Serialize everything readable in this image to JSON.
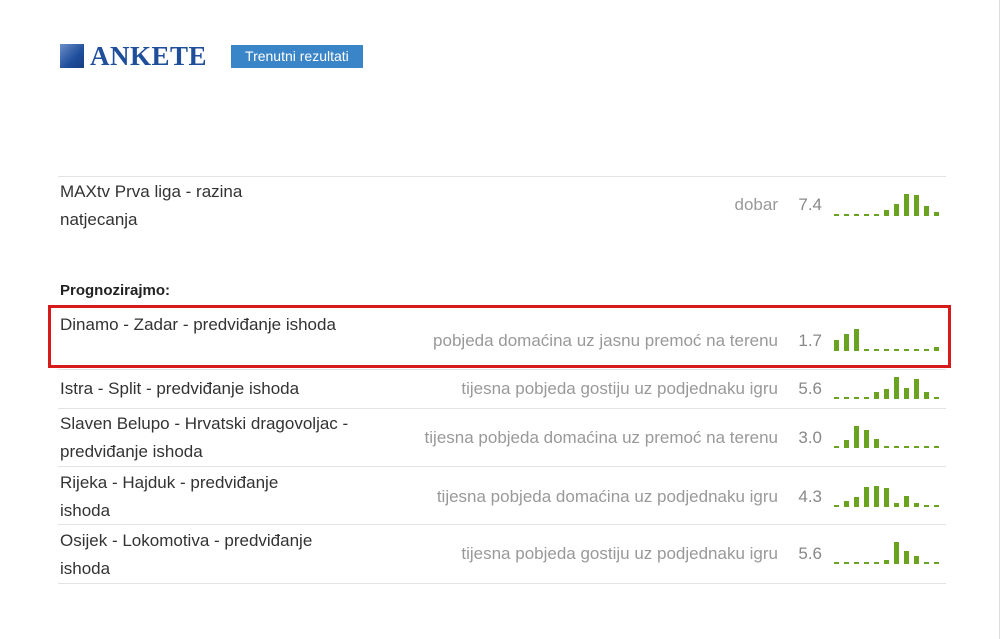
{
  "header": {
    "title": "ANKETE",
    "results_link": "Trenutni rezultati"
  },
  "league_poll": {
    "name": "MAXtv Prva liga - razina natjecanja",
    "answer": "dobar",
    "score": "7.4",
    "distribution": [
      0,
      0,
      0,
      0,
      0,
      0.25,
      0.55,
      1.0,
      0.95,
      0.45,
      0.15
    ]
  },
  "section_title": "Prognozirajmo:",
  "match_polls": [
    {
      "name": "Dinamo - Zadar - predviđanje ishoda",
      "answer": "pobjeda domaćina uz jasnu premoć na terenu",
      "score": "1.7",
      "distribution": [
        0.5,
        0.75,
        1.0,
        0,
        0,
        0,
        0,
        0,
        0,
        0,
        0.1
      ],
      "highlighted": true
    },
    {
      "name": "Istra - Split - predviđanje ishoda",
      "answer": "tijesna pobjeda gostiju uz podjednaku igru",
      "score": "5.6",
      "distribution": [
        0,
        0,
        0,
        0,
        0.3,
        0.45,
        1.0,
        0.5,
        0.9,
        0.3,
        0
      ]
    },
    {
      "name": "Slaven Belupo - Hrvatski dragovoljac - predviđanje ishoda",
      "answer": "tijesna pobjeda domaćina uz premoć na terenu",
      "score": "3.0",
      "distribution": [
        0,
        0.35,
        1.0,
        0.8,
        0.4,
        0,
        0,
        0,
        0,
        0,
        0
      ]
    },
    {
      "name": "Rijeka - Hajduk - predviđanje ishoda",
      "answer": "tijesna pobjeda domaćina uz podjednaku igru",
      "score": "4.3",
      "distribution": [
        0,
        0.25,
        0.45,
        0.9,
        0.95,
        0.85,
        0.15,
        0.5,
        0.2,
        0,
        0
      ]
    },
    {
      "name": "Osijek - Lokomotiva - predviđanje ishoda",
      "answer": "tijesna pobjeda gostiju uz podjednaku igru",
      "score": "5.6",
      "distribution": [
        0,
        0,
        0,
        0,
        0,
        0.2,
        1.0,
        0.6,
        0.35,
        0,
        0
      ]
    }
  ],
  "colors": {
    "brand": "#1f4e9b",
    "link_bg": "#3a84c8",
    "bar": "#6aa31f",
    "highlight": "#d81a1a"
  }
}
